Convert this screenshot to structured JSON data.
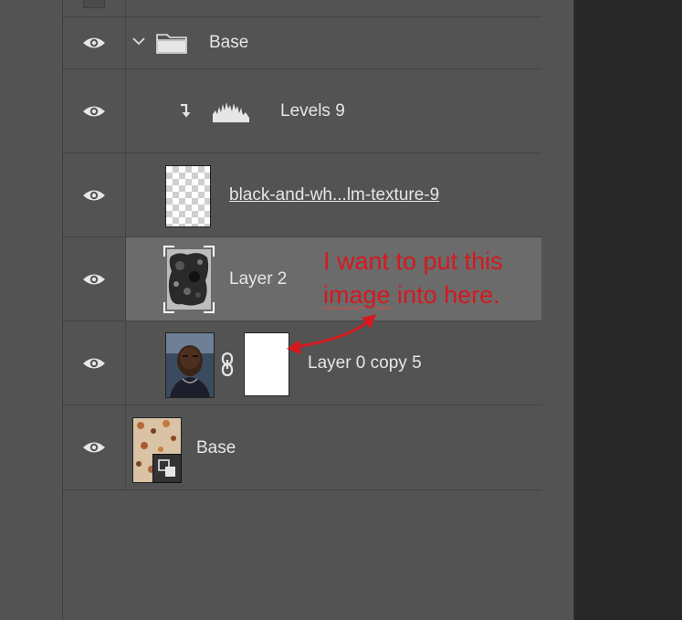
{
  "panel": {
    "rows": [
      {
        "name": "Base",
        "type": "group"
      },
      {
        "name": "Levels 9",
        "type": "adjustment"
      },
      {
        "name": "black-and-wh...lm-texture-9",
        "type": "pixel"
      },
      {
        "name": "Layer 2",
        "type": "pixel",
        "selected": true
      },
      {
        "name": "Layer 0 copy 5",
        "type": "masked"
      },
      {
        "name": "Base",
        "type": "smart-object"
      }
    ]
  },
  "annotation": {
    "line1": "I want to put this",
    "line2_underlined": "image",
    "line2_rest": " into here.",
    "color": "#d4191f"
  },
  "icons": {
    "eye": "eye-icon",
    "folder": "folder-icon",
    "chevron": "chevron-down-icon",
    "clip": "clipping-arrow-icon",
    "histogram": "levels-histogram-icon",
    "chain": "link-chain-icon",
    "smart": "smart-object-badge-icon"
  }
}
